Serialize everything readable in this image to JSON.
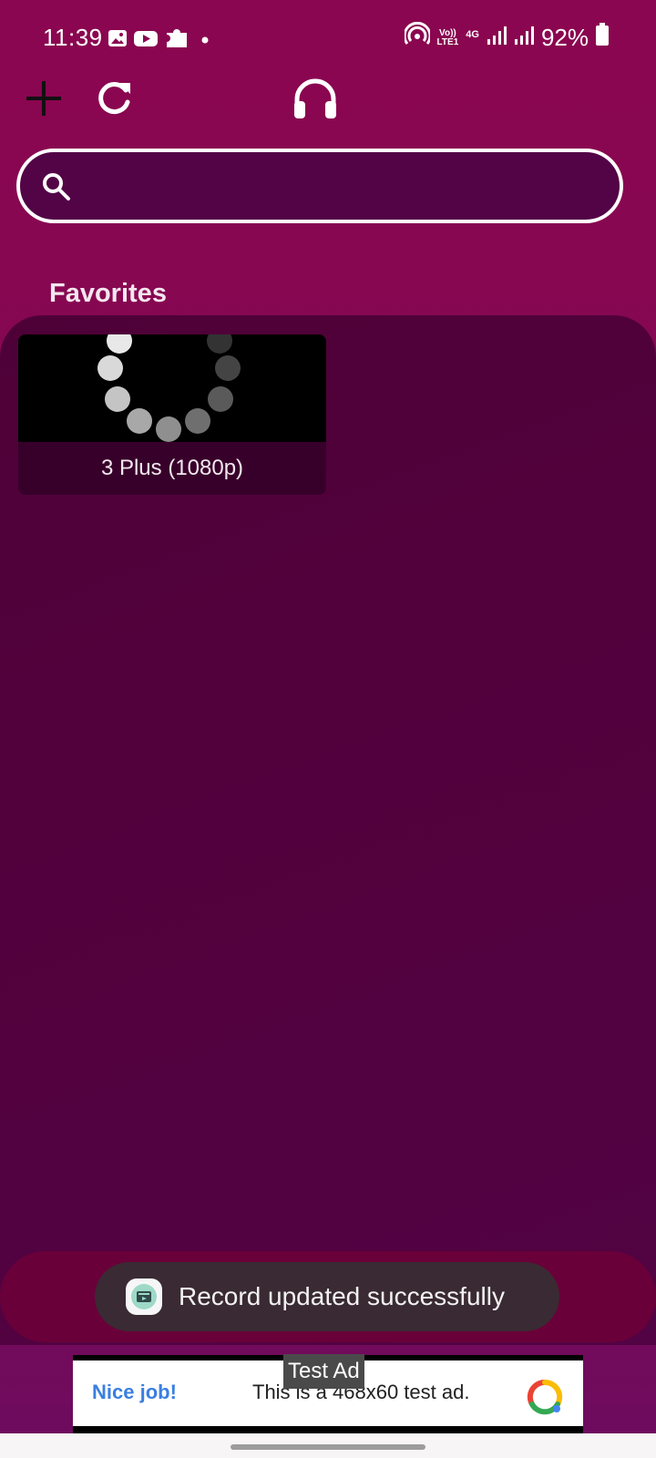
{
  "status_bar": {
    "time": "11:39",
    "battery": "92%",
    "network_top": "Vo))",
    "network_bottom": "LTE1",
    "network_gen": "4G",
    "notification_icons": [
      "gallery-icon",
      "youtube-icon",
      "puzzle-icon",
      "dot-icon"
    ],
    "system_icons": [
      "hotspot-icon",
      "signal-icon",
      "signal-icon",
      "battery-icon"
    ]
  },
  "toolbar": {
    "icons": [
      "add-icon",
      "refresh-icon",
      "headphones-icon"
    ]
  },
  "search": {
    "value": "",
    "placeholder": ""
  },
  "favorites": {
    "title": "Favorites",
    "items": [
      {
        "label": "3 Plus (1080p)"
      }
    ]
  },
  "toast": {
    "message": "Record updated successfully"
  },
  "ad": {
    "tag": "Test Ad",
    "headline": "Nice job!",
    "body": "This is a 468x60 test ad."
  },
  "colors": {
    "background": "#8b0650",
    "panel": "#4e0137",
    "search_fill": "#530446",
    "bottom_nav": "#6a0039",
    "toast": "#3a2a33"
  }
}
